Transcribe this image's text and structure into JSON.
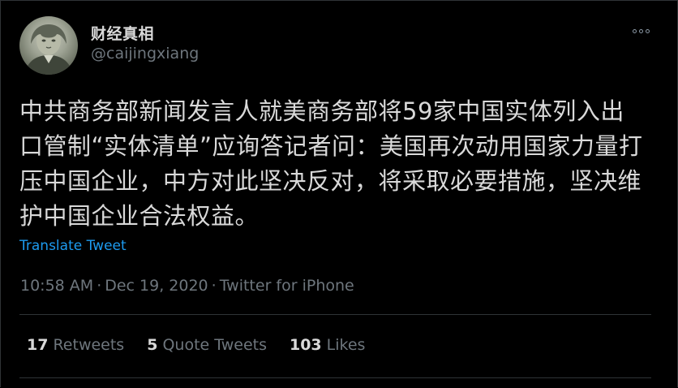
{
  "tweet": {
    "display_name": "财经真相",
    "handle": "@caijingxiang",
    "text": "中共商务部新闻发言人就美商务部将59家中国实体列入出口管制“实体清单”应询答记者问：美国再次动用国家力量打压中国企业，中方对此坚决反对，将采取必要措施，坚决维护中国企业合法权益。",
    "translate_label": "Translate Tweet",
    "time": "10:58 AM",
    "date": "Dec 19, 2020",
    "source": "Twitter for iPhone",
    "separator": "·"
  },
  "stats": {
    "retweets_count": "17",
    "retweets_label": "Retweets",
    "quote_count": "5",
    "quote_label": "Quote Tweets",
    "likes_count": "103",
    "likes_label": "Likes"
  },
  "icons": {
    "more": "more-options-icon",
    "avatar": "profile-avatar"
  },
  "colors": {
    "background": "#000000",
    "text": "#d9d9d9",
    "secondary": "#6e767d",
    "link": "#1d9bf0",
    "divider": "#2f3336"
  }
}
